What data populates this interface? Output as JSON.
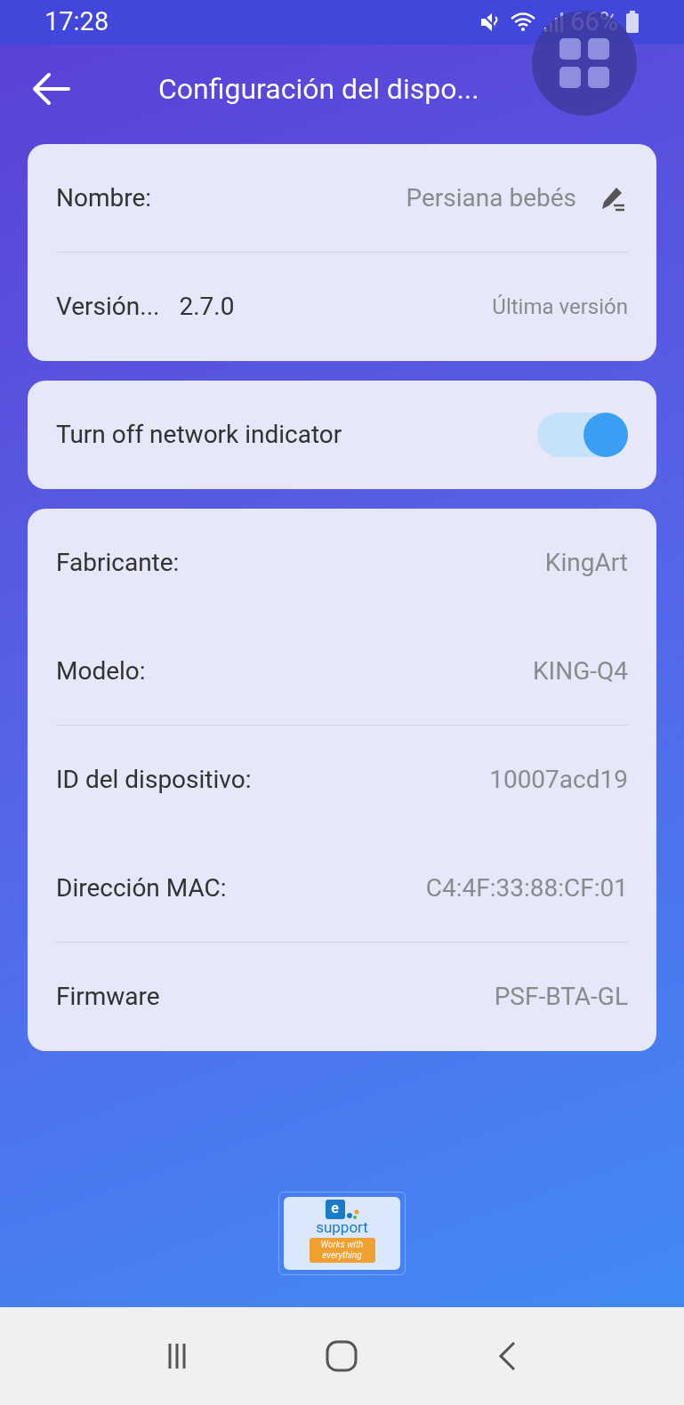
{
  "status_bar": {
    "time": "17:28",
    "battery": "66%"
  },
  "header": {
    "title": "Configuración del dispo..."
  },
  "info_card": {
    "rows": [
      {
        "kind": "edit",
        "label": "Nombre:",
        "value": "Persiana bebés"
      },
      {
        "kind": "version",
        "label": "Versión...",
        "version": "2.7.0",
        "value": "Última versión"
      }
    ]
  },
  "toggle_card": {
    "label": "Turn off network indicator",
    "on": true
  },
  "details_card": {
    "rows": [
      {
        "label": "Fabricante:",
        "value": "KingArt",
        "divider_below": false
      },
      {
        "label": "Modelo:",
        "value": "KING-Q4",
        "divider_below": true
      },
      {
        "label": "ID del dispositivo:",
        "value": "10007acd19",
        "divider_below": false
      },
      {
        "label": "Dirección MAC:",
        "value": "C4:4F:33:88:CF:01",
        "divider_below": true
      },
      {
        "label": "Firmware",
        "value": "PSF-BTA-GL",
        "divider_below": false
      }
    ]
  },
  "badge": {
    "brand": "support",
    "brand_initial": "e",
    "tagline": "Works with everything"
  }
}
